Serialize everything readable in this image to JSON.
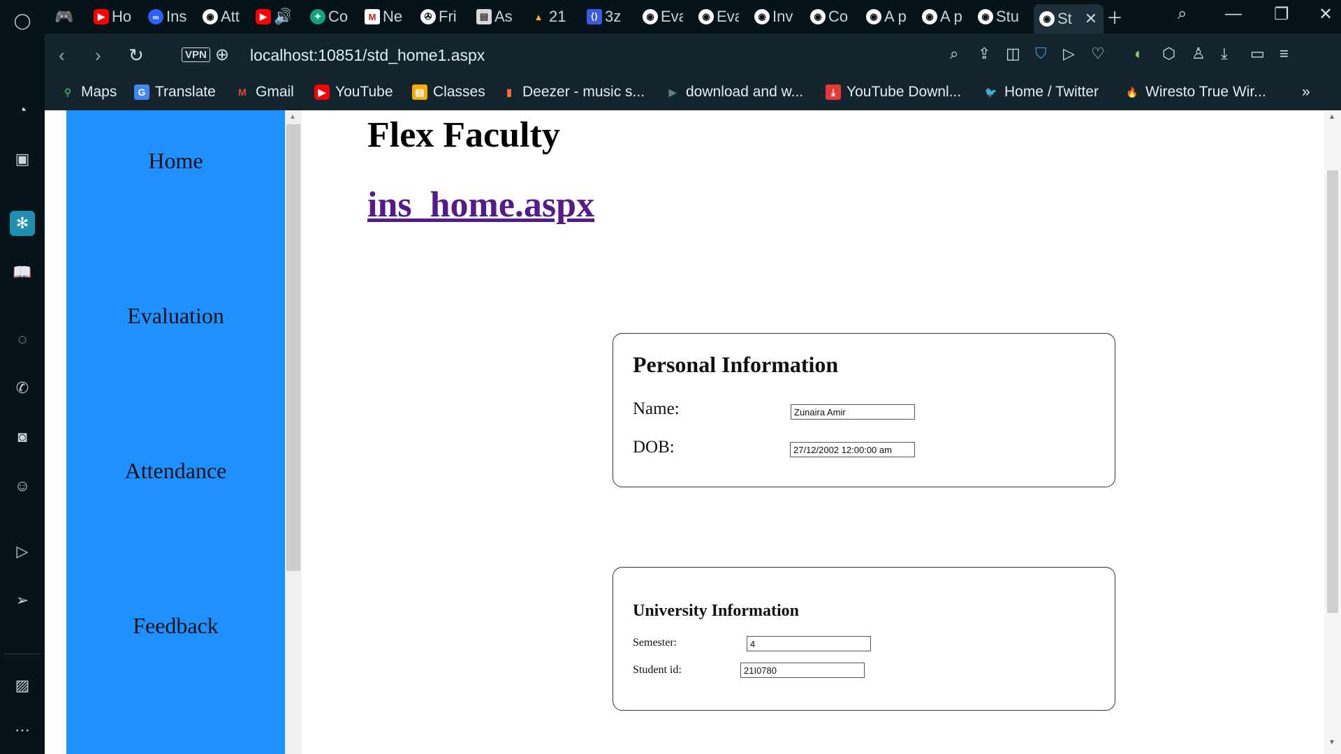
{
  "tabs": [
    {
      "label": "Ho",
      "icon": "youtube-icon",
      "color": "#ff0000"
    },
    {
      "label": "Ins",
      "icon": "link-icon",
      "color": "#2a62ff"
    },
    {
      "label": "Att",
      "icon": "globe-icon",
      "color": "#ffffff"
    },
    {
      "label": "",
      "icon": "youtube-icon",
      "color": "#ff0000"
    },
    {
      "label": "Co",
      "icon": "chatgpt-icon",
      "color": "#10a37f"
    },
    {
      "label": "Ne",
      "icon": "gmail-icon",
      "color": "#c5221f"
    },
    {
      "label": "Fri",
      "icon": "film-icon",
      "color": "#ffffff"
    },
    {
      "label": "As",
      "icon": "classroom-icon",
      "color": "#d8d8d8"
    },
    {
      "label": "21",
      "icon": "drive-icon",
      "color": "#fbbc04"
    },
    {
      "label": "3z",
      "icon": "code-icon",
      "color": "#3b5bdb"
    },
    {
      "label": "Eva",
      "icon": "globe-icon",
      "color": "#ffffff"
    },
    {
      "label": "Eva",
      "icon": "globe-icon",
      "color": "#ffffff"
    },
    {
      "label": "Inv",
      "icon": "globe-icon",
      "color": "#ffffff"
    },
    {
      "label": "Co",
      "icon": "globe-icon",
      "color": "#ffffff"
    },
    {
      "label": "A p",
      "icon": "globe-icon",
      "color": "#ffffff"
    },
    {
      "label": "A p",
      "icon": "globe-icon",
      "color": "#ffffff"
    },
    {
      "label": "Stu",
      "icon": "globe-icon",
      "color": "#ffffff"
    },
    {
      "label": "St",
      "icon": "globe-icon",
      "color": "#ffffff",
      "active": true
    }
  ],
  "address": {
    "vpn_label": "VPN",
    "url": "localhost:10851/std_home1.aspx"
  },
  "bookmarks": [
    {
      "label": "Maps",
      "icon": "maps-icon"
    },
    {
      "label": "Translate",
      "icon": "translate-icon"
    },
    {
      "label": "Gmail",
      "icon": "gmail-icon"
    },
    {
      "label": "YouTube",
      "icon": "youtube-icon"
    },
    {
      "label": "Classes",
      "icon": "classroom-icon"
    },
    {
      "label": "Deezer - music s...",
      "icon": "deezer-icon"
    },
    {
      "label": "download and w...",
      "icon": "play-store-icon"
    },
    {
      "label": "YouTube Downl...",
      "icon": "download-icon"
    },
    {
      "label": "Home / Twitter",
      "icon": "twitter-icon"
    },
    {
      "label": "Wiresto True Wir...",
      "icon": "flame-icon"
    }
  ],
  "sidebar_nav": [
    "Home",
    "Evaluation",
    "Attendance",
    "Feedback"
  ],
  "page": {
    "title": "Flex Faculty",
    "link": "ins_home.aspx"
  },
  "personal_info": {
    "heading": "Personal Information",
    "name_label": "Name:",
    "name_value": "Zunaira Amir",
    "dob_label": "DOB:",
    "dob_value": "27/12/2002 12:00:00 am"
  },
  "university_info": {
    "heading": "University Information",
    "semester_label": "Semester:",
    "semester_value": "4",
    "student_id_label": "Student id:",
    "student_id_value": "21I0780"
  },
  "colors": {
    "sidebar_nav_bg": "#1e90ff",
    "link_visited": "#551a8b",
    "browser_dark": "#06141a"
  }
}
